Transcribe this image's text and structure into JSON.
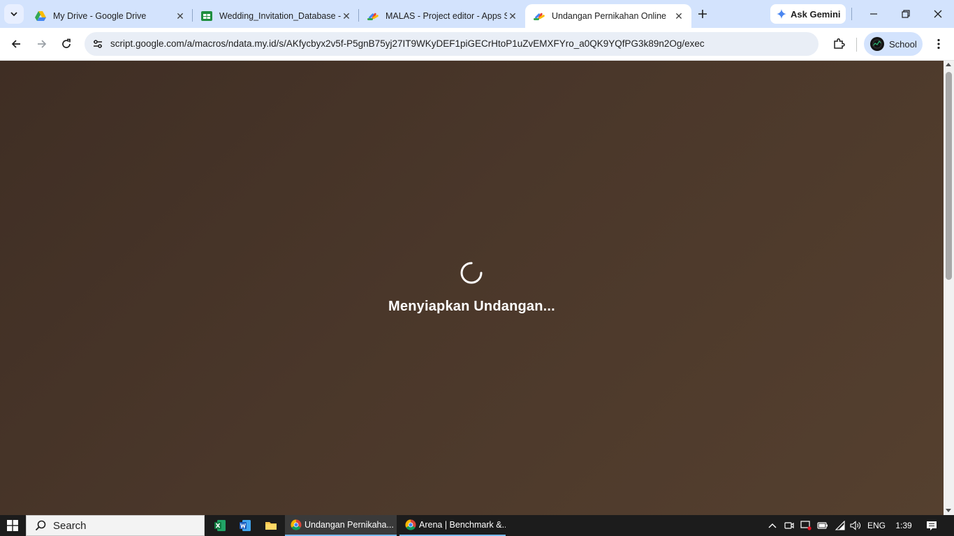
{
  "browser": {
    "tabs": [
      {
        "title": "My Drive - Google Drive",
        "icon": "google-drive-icon",
        "active": false
      },
      {
        "title": "Wedding_Invitation_Database -",
        "icon": "google-sheets-icon",
        "active": false
      },
      {
        "title": "MALAS - Project editor - Apps S",
        "icon": "apps-script-icon",
        "active": false
      },
      {
        "title": "Undangan Pernikahan Online",
        "icon": "apps-script-icon",
        "active": true
      }
    ],
    "gemini_label": "Ask Gemini",
    "url_host": "script.google.com",
    "url_path": "/a/macros/ndata.my.id/s/AKfycbyx2v5f-P5gnB75yj27IT9WKyDEF1piGECrHtoP1uZvEMXFYro_a0QK9YQfPG3k89n2Og/exec",
    "profile_label": "School"
  },
  "page": {
    "loading_text": "Menyiapkan Undangan..."
  },
  "taskbar": {
    "search_label": "Search",
    "windows": [
      {
        "title": "Undangan Pernikaha...",
        "icon": "chrome-icon",
        "active": true
      },
      {
        "title": "Arena | Benchmark &...",
        "icon": "chrome-icon",
        "active": false
      }
    ],
    "language": "ENG",
    "time": "1:39"
  },
  "colors": {
    "tabstrip": "#d3e3fd",
    "page_background": "#4a372a",
    "taskbar": "#1c1c1c"
  }
}
